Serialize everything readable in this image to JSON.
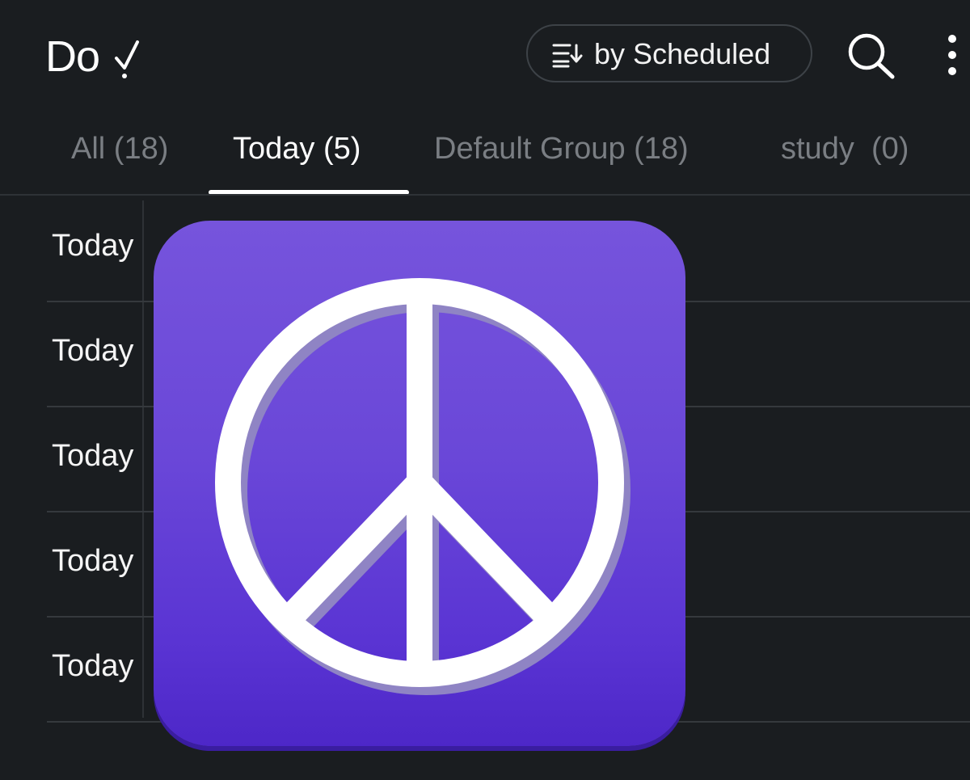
{
  "header": {
    "app_title": "Do",
    "sort_label": "by Scheduled",
    "sort_icon": "sort-descending-icon",
    "search_icon": "search-icon",
    "more_icon": "more-vertical-icon"
  },
  "tabs": [
    {
      "label": "All (18)",
      "active": false
    },
    {
      "label": "Today (5)",
      "active": true
    },
    {
      "label": "Default Group (18)",
      "active": false
    },
    {
      "label": "study  (0)",
      "active": false
    }
  ],
  "rows": [
    {
      "label": "Today"
    },
    {
      "label": "Today"
    },
    {
      "label": "Today"
    },
    {
      "label": "Today"
    },
    {
      "label": "Today"
    }
  ],
  "overlay": {
    "icon": "peace-sign-icon",
    "background_color": "#6a47d8",
    "symbol_color": "#ffffff"
  },
  "colors": {
    "background": "#1a1d20",
    "inactive_tab": "#7a7e83",
    "active_tab": "#ffffff"
  }
}
